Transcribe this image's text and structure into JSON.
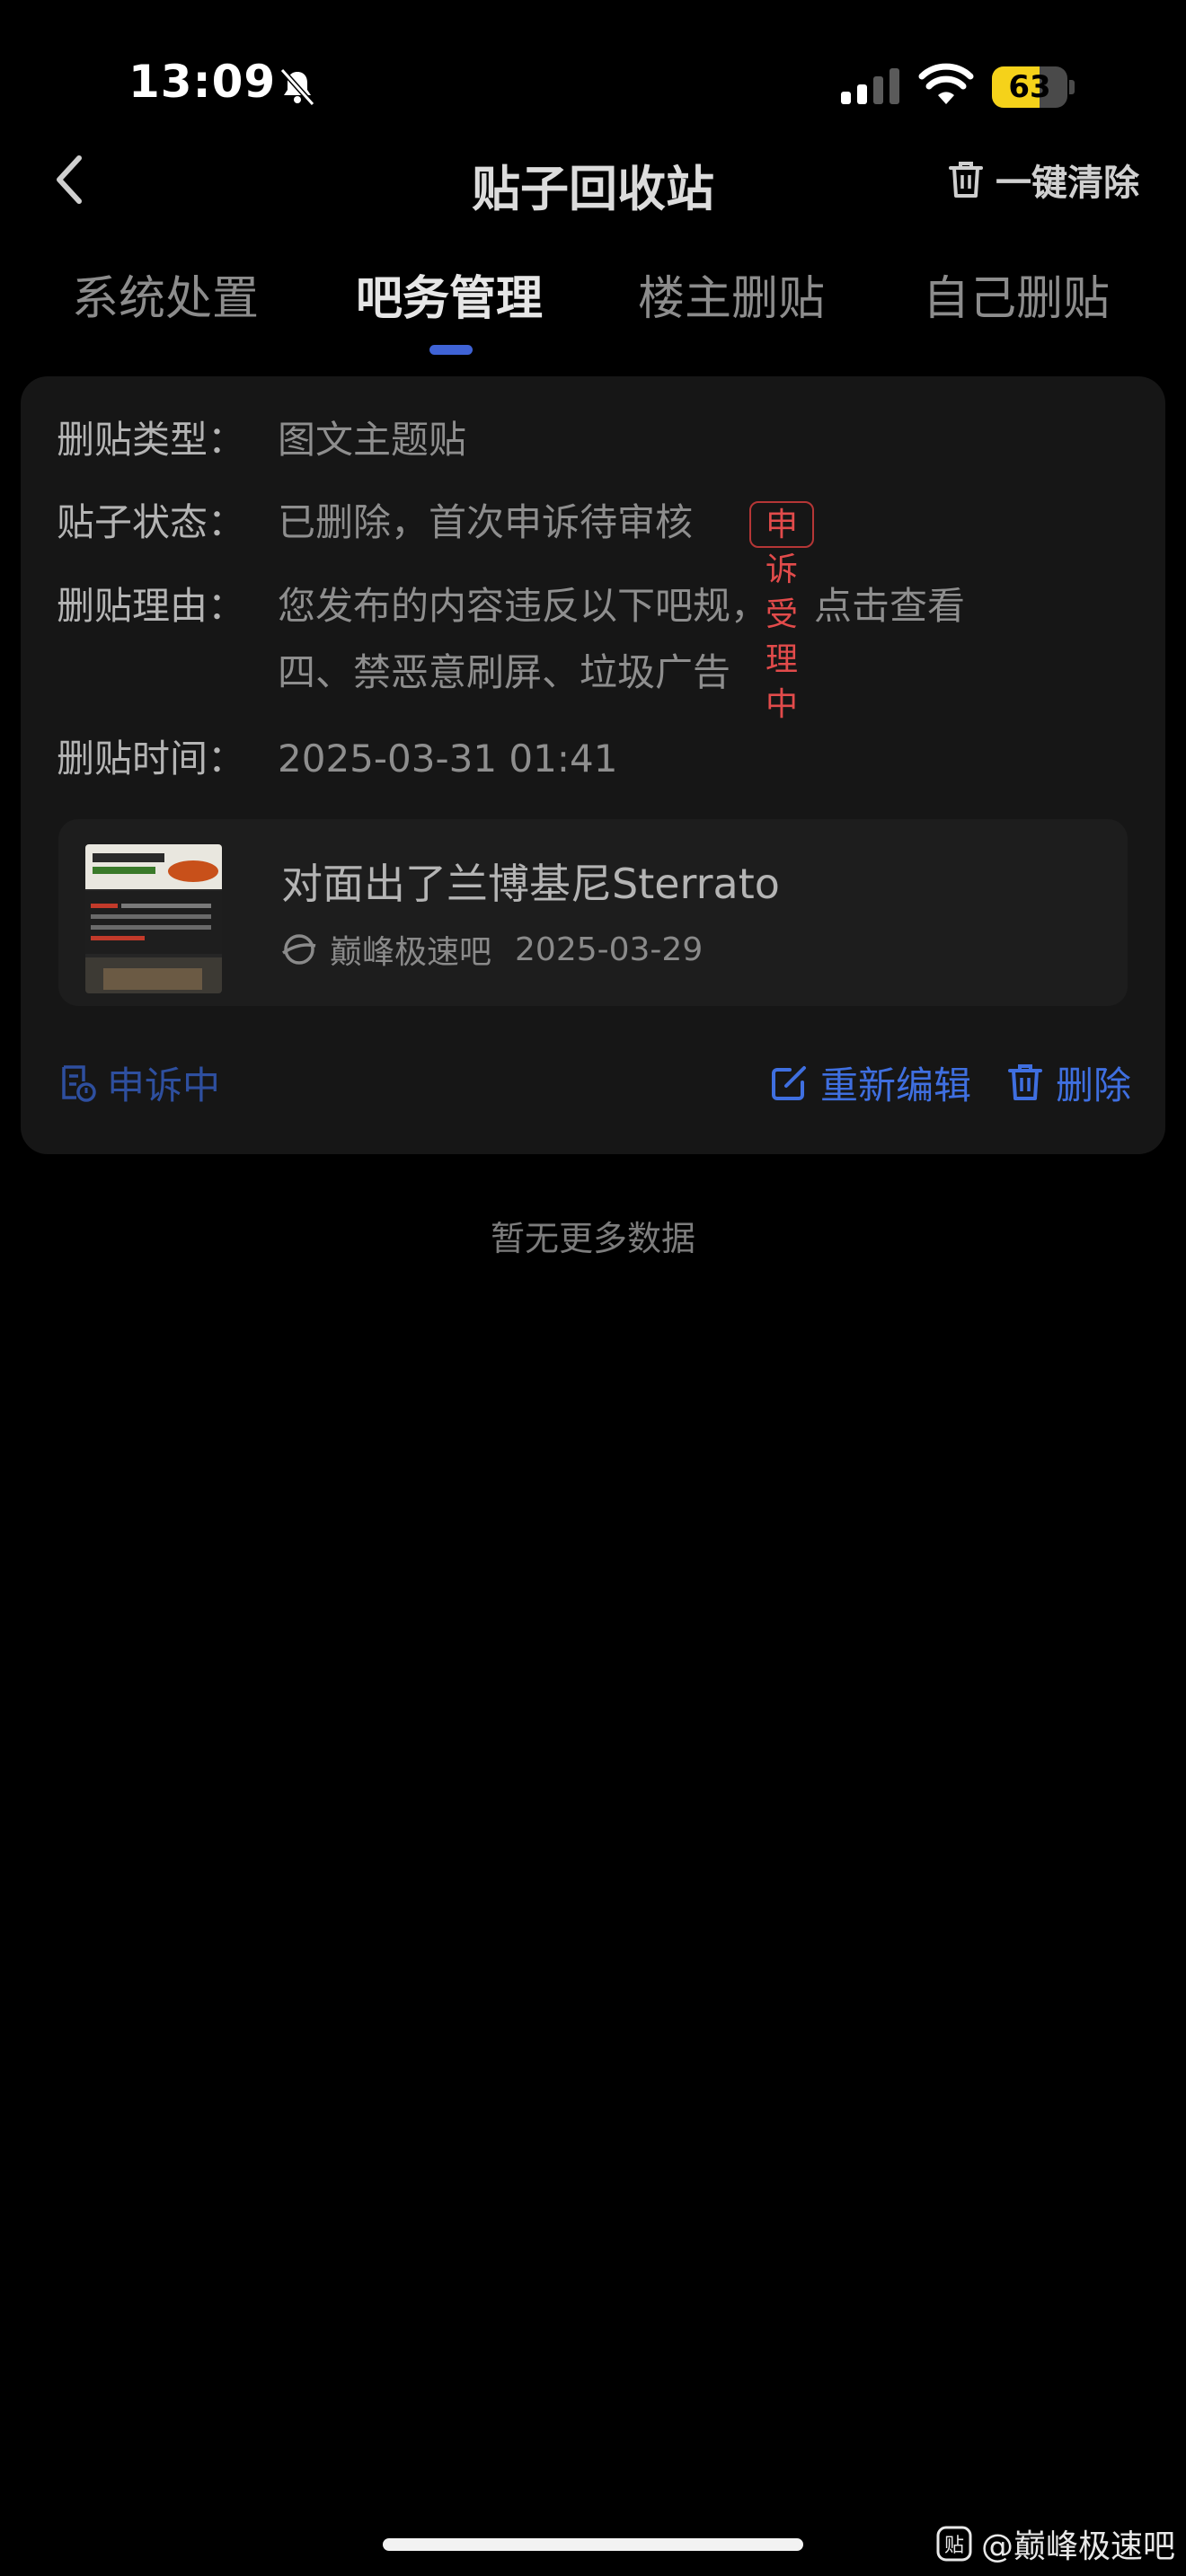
{
  "status_bar": {
    "time": "13:09",
    "battery": "63",
    "battery_level": 0.63
  },
  "nav": {
    "title": "贴子回收站",
    "clear_all": "一键清除"
  },
  "tabs": [
    {
      "label": "系统处置",
      "active": false
    },
    {
      "label": "吧务管理",
      "active": true
    },
    {
      "label": "楼主删贴",
      "active": false
    },
    {
      "label": "自己删贴",
      "active": false
    }
  ],
  "record": {
    "type_label": "删贴类型：",
    "type_value": "图文主题贴",
    "status_label": "贴子状态：",
    "status_value": "已删除，首次申诉待审核",
    "status_badge": "申诉受理中",
    "reason_label": "删贴理由：",
    "reason_line1": "您发布的内容违反以下吧规，",
    "reason_link": "点击查看",
    "reason_line2": "四、禁恶意刷屏、垃圾广告",
    "time_label": "删贴时间：",
    "time_value": "2025-03-31 01:41",
    "post": {
      "title": "对面出了兰博基尼Sterrato",
      "forum": "巅峰极速吧",
      "date": "2025-03-29"
    },
    "appeal_status": "申诉中",
    "edit_label": "重新编辑",
    "delete_label": "删除"
  },
  "footer_text": "暂无更多数据",
  "watermark": "@巅峰极速吧",
  "colors": {
    "accent": "#3f6fe0",
    "badge_red": "#e24b4b",
    "battery": "#f5d21a"
  }
}
